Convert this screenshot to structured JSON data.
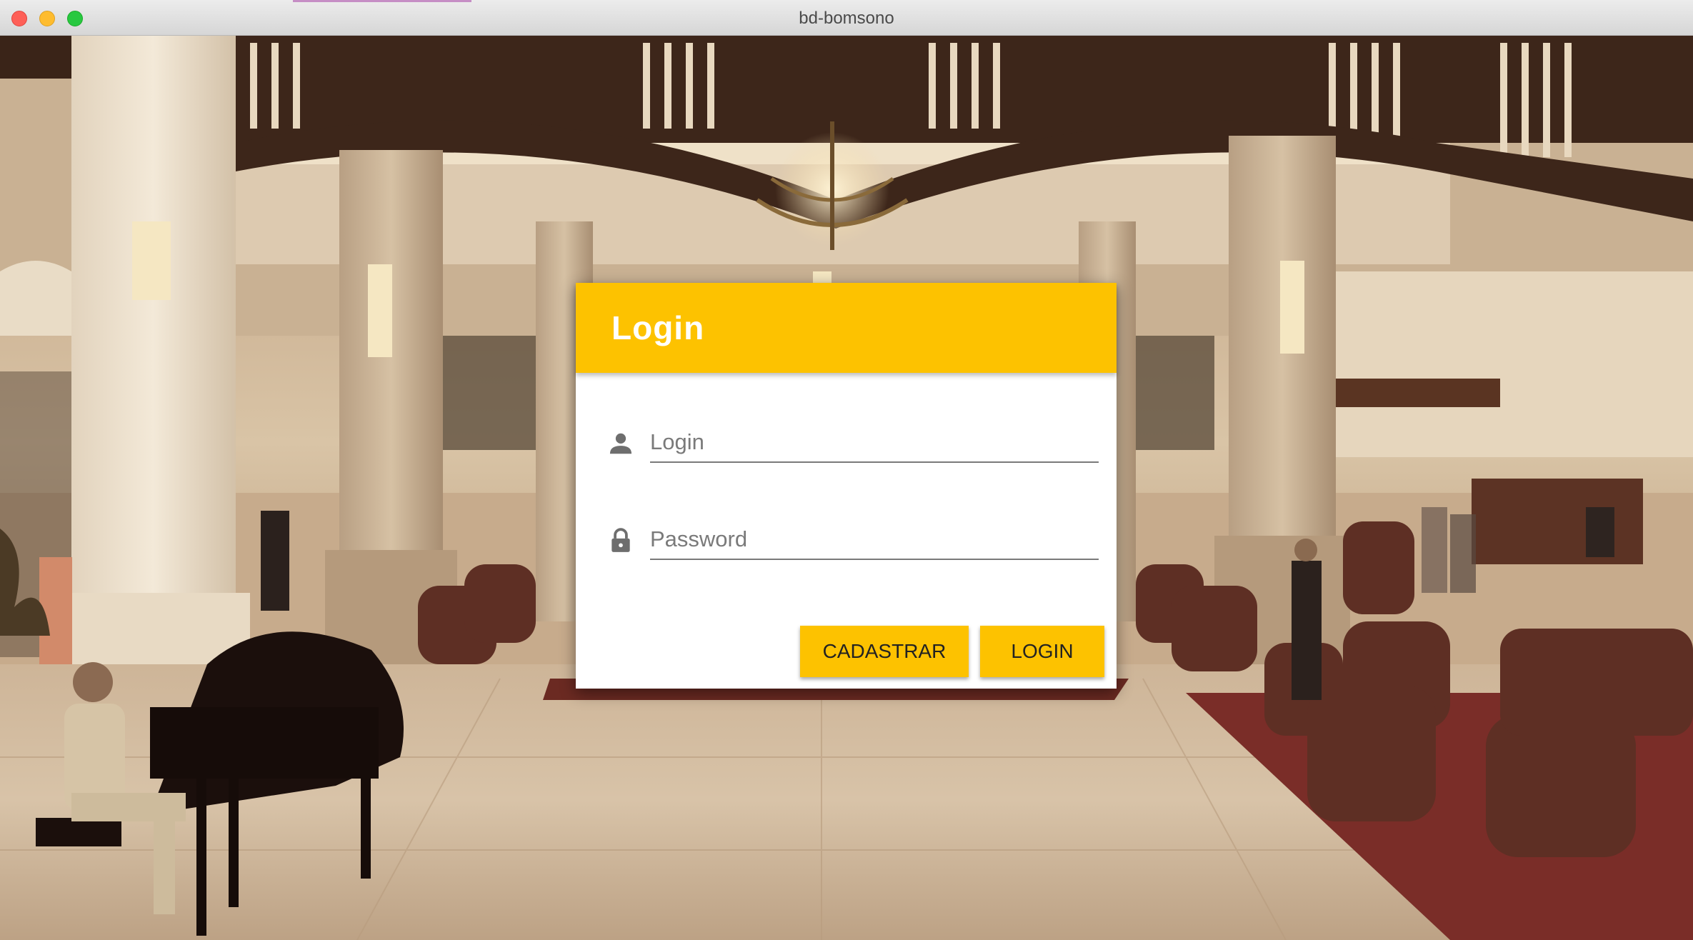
{
  "window": {
    "title": "bd-bomsono"
  },
  "login_card": {
    "header_title": "Login",
    "login_field": {
      "placeholder": "Login",
      "value": "",
      "icon": "person-icon"
    },
    "password_field": {
      "placeholder": "Password",
      "value": "",
      "icon": "lock-icon"
    },
    "buttons": {
      "register_label": "CADASTRAR",
      "login_label": "LOGIN"
    }
  },
  "colors": {
    "accent": "#fdc200",
    "card_background": "#ffffff",
    "input_underline": "#7a7a7a",
    "title_text": "#ffffff"
  },
  "background": {
    "description_icon": "hotel-lobby-photo"
  }
}
